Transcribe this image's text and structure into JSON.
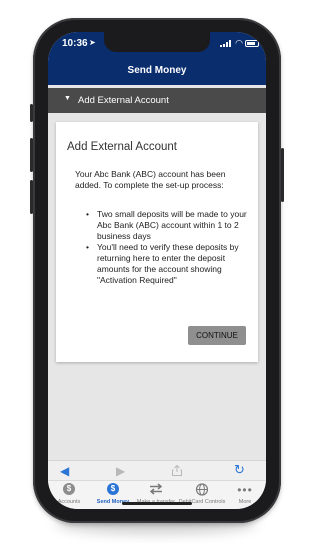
{
  "status_bar": {
    "time": "10:36",
    "location_icon": "location-arrow-icon",
    "signal_icon": "cellular-signal-icon",
    "wifi_icon": "wifi-icon",
    "battery_icon": "battery-icon"
  },
  "header": {
    "title": "Send Money",
    "background_color": "#0a2d6e"
  },
  "section": {
    "label": "Add External Account",
    "caret_icon": "caret-down-icon",
    "background_color": "#4a4a4a"
  },
  "card": {
    "title": "Add External Account",
    "intro": "Your Abc Bank (ABC) account has been added. To complete the set-up process:",
    "bullets": [
      "Two small deposits will be made to your Abc Bank (ABC) account within 1 to 2 business days",
      "You'll need to verify these deposits by returning here to enter the deposit amounts for the account showing \"Activation Required\""
    ],
    "continue_label": "CONTINUE"
  },
  "browser_bar": {
    "back_icon": "back-arrow-icon",
    "forward_icon": "forward-arrow-icon",
    "share_icon": "share-icon",
    "reload_icon": "reload-icon"
  },
  "tab_bar": {
    "accent_color": "#1f5fbf",
    "items": [
      {
        "label": "Accounts",
        "icon": "dollar-circle-icon",
        "active": false
      },
      {
        "label": "Send Money",
        "icon": "send-money-icon",
        "active": true
      },
      {
        "label": "Make a transfer",
        "icon": "transfer-arrows-icon",
        "active": false
      },
      {
        "label": "DebitCard Controls",
        "icon": "debit-card-globe-icon",
        "active": false
      },
      {
        "label": "More",
        "icon": "more-dots-icon",
        "active": false
      }
    ]
  }
}
